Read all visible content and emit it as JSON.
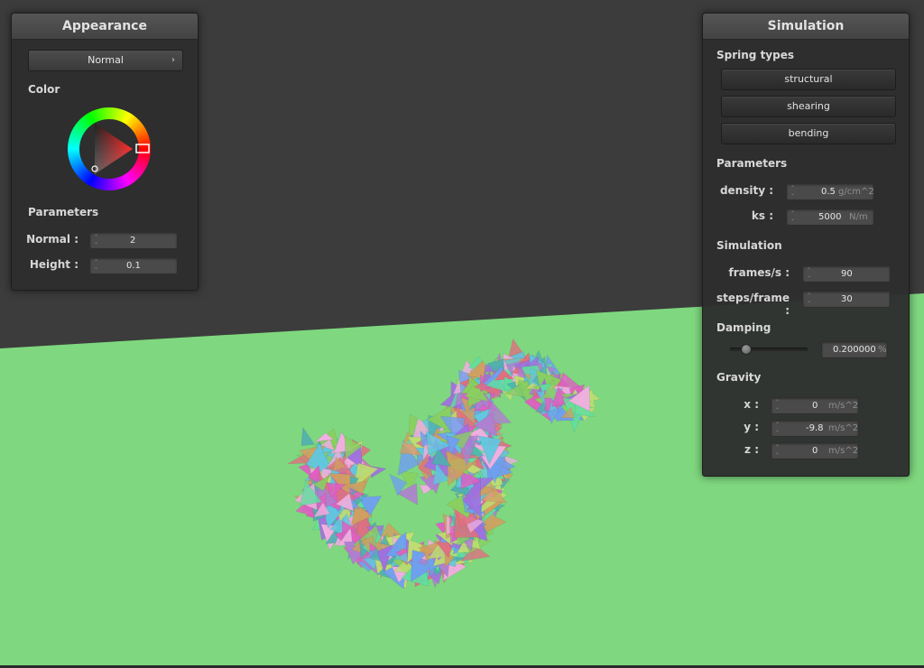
{
  "colors": {
    "floor": "#7fd87f",
    "background": "#3c3c3c"
  },
  "appearance": {
    "title": "Appearance",
    "shader_dropdown": "Normal",
    "color_label": "Color",
    "parameters_label": "Parameters",
    "normal": {
      "label": "Normal :",
      "value": "2"
    },
    "height": {
      "label": "Height :",
      "value": "0.1"
    }
  },
  "simulation": {
    "title": "Simulation",
    "spring_types_label": "Spring types",
    "buttons": {
      "structural": "structural",
      "shearing": "shearing",
      "bending": "bending"
    },
    "parameters_label": "Parameters",
    "density": {
      "label": "density :",
      "value": "0.5",
      "unit": "g/cm^2"
    },
    "ks": {
      "label": "ks :",
      "value": "5000",
      "unit": "N/m"
    },
    "simulation_label": "Simulation",
    "fps": {
      "label": "frames/s :",
      "value": "90"
    },
    "steps": {
      "label": "steps/frame :",
      "value": "30"
    },
    "damping_label": "Damping",
    "damping": {
      "value": "0.200000",
      "unit": "%",
      "slider_fraction": 0.2
    },
    "gravity_label": "Gravity",
    "gx": {
      "label": "x :",
      "value": "0",
      "unit": "m/s^2"
    },
    "gy": {
      "label": "y :",
      "value": "-9.8",
      "unit": "m/s^2"
    },
    "gz": {
      "label": "z :",
      "value": "0",
      "unit": "m/s^2"
    }
  }
}
